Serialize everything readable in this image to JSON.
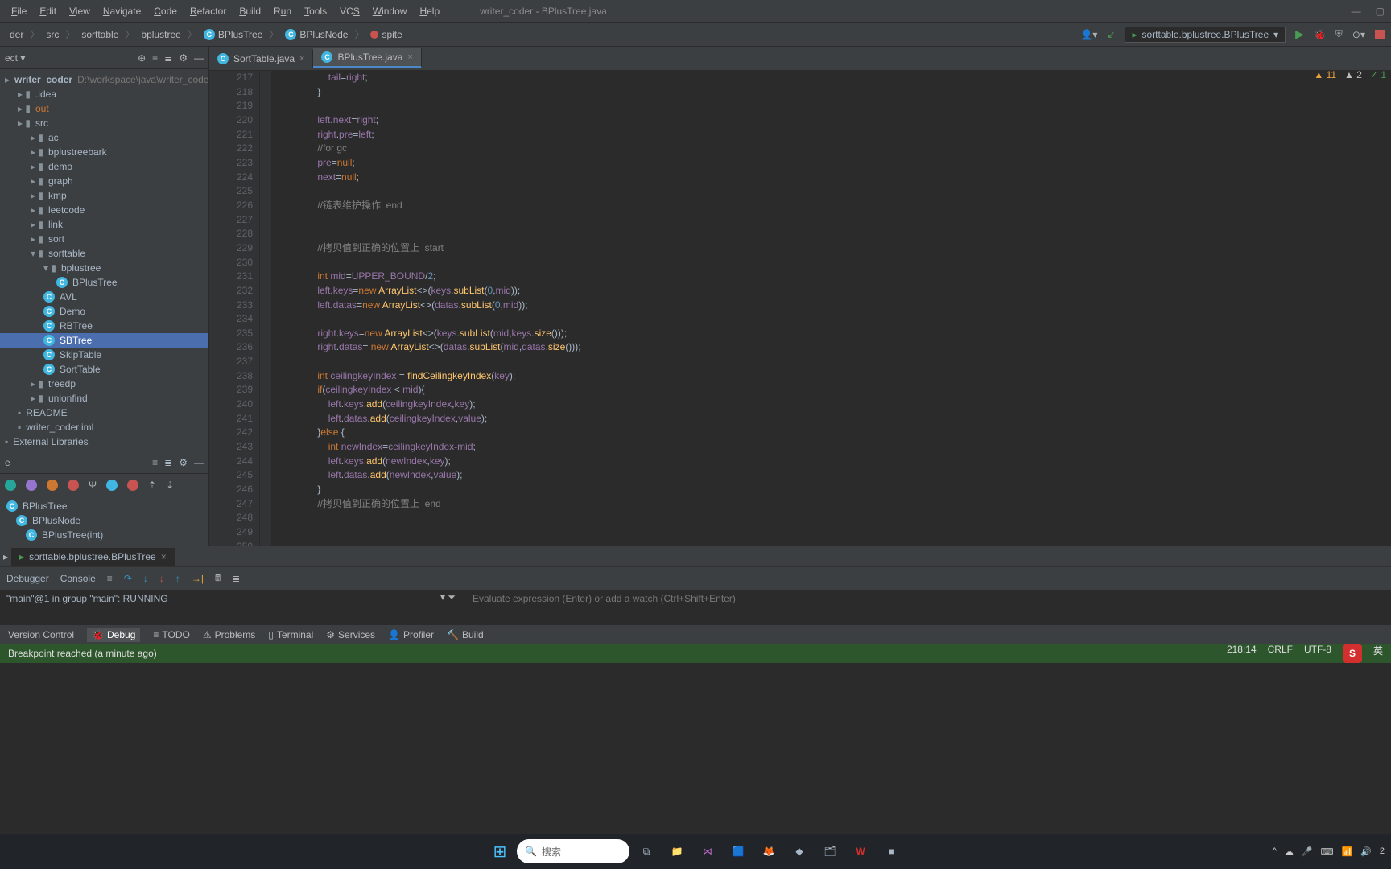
{
  "window_title": "writer_coder - BPlusTree.java",
  "menu": [
    "File",
    "Edit",
    "View",
    "Navigate",
    "Code",
    "Refactor",
    "Build",
    "Run",
    "Tools",
    "VCS",
    "Window",
    "Help"
  ],
  "breadcrumbs": [
    {
      "label": "writer_coder",
      "icon": "folder"
    },
    {
      "label": "src",
      "icon": null
    },
    {
      "label": "sorttable",
      "icon": null
    },
    {
      "label": "bplustree",
      "icon": null
    },
    {
      "label": "BPlusTree",
      "icon": "class"
    },
    {
      "label": "BPlusNode",
      "icon": "class"
    },
    {
      "label": "spite",
      "icon": "method"
    }
  ],
  "run_config": "sorttable.bplustree.BPlusTree",
  "project": {
    "root_label": "writer_coder",
    "root_path": "D:\\workspace\\java\\writer_code",
    "items": [
      {
        "label": ".idea",
        "type": "folder",
        "indent": 1
      },
      {
        "label": "out",
        "type": "folder-out",
        "indent": 1
      },
      {
        "label": "src",
        "type": "folder-src",
        "indent": 1
      },
      {
        "label": "ac",
        "type": "folder",
        "indent": 2
      },
      {
        "label": "bplustreebark",
        "type": "folder",
        "indent": 2
      },
      {
        "label": "demo",
        "type": "folder",
        "indent": 2
      },
      {
        "label": "graph",
        "type": "folder",
        "indent": 2
      },
      {
        "label": "kmp",
        "type": "folder",
        "indent": 2
      },
      {
        "label": "leetcode",
        "type": "folder",
        "indent": 2
      },
      {
        "label": "link",
        "type": "folder",
        "indent": 2
      },
      {
        "label": "sort",
        "type": "folder",
        "indent": 2
      },
      {
        "label": "sorttable",
        "type": "folder",
        "indent": 2,
        "expanded": true
      },
      {
        "label": "bplustree",
        "type": "folder",
        "indent": 3,
        "expanded": true
      },
      {
        "label": "BPlusTree",
        "type": "class",
        "indent": 4
      },
      {
        "label": "AVL",
        "type": "class",
        "indent": 3
      },
      {
        "label": "Demo",
        "type": "class",
        "indent": 3
      },
      {
        "label": "RBTree",
        "type": "class",
        "indent": 3
      },
      {
        "label": "SBTree",
        "type": "class",
        "indent": 3,
        "selected": true
      },
      {
        "label": "SkipTable",
        "type": "class",
        "indent": 3
      },
      {
        "label": "SortTable",
        "type": "class",
        "indent": 3
      },
      {
        "label": "treedp",
        "type": "folder",
        "indent": 2
      },
      {
        "label": "unionfind",
        "type": "folder",
        "indent": 2
      },
      {
        "label": "README",
        "type": "file",
        "indent": 1
      },
      {
        "label": "writer_coder.iml",
        "type": "file",
        "indent": 1
      },
      {
        "label": "External Libraries",
        "type": "lib",
        "indent": 0
      }
    ]
  },
  "structure_items": [
    {
      "label": "BPlusTree"
    },
    {
      "label": "BPlusNode"
    },
    {
      "label": "BPlusTree(int)"
    }
  ],
  "editor_tabs": [
    {
      "label": "SortTable.java",
      "icon": "class",
      "active": false
    },
    {
      "label": "BPlusTree.java",
      "icon": "class",
      "active": true
    }
  ],
  "inspections": {
    "warnings": 11,
    "weak": 2,
    "ok": "✓"
  },
  "code": {
    "first_line": 217,
    "lines": [
      "                    tail=right;",
      "                }",
      "",
      "                left.next=right;",
      "                right.pre=left;",
      "                //for gc",
      "                pre=null;",
      "                next=null;",
      "",
      "                //链表维护操作  end",
      "",
      "",
      "                //拷贝值到正确的位置上  start",
      "",
      "                int mid=UPPER_BOUND/2;",
      "                left.keys=new ArrayList<>(keys.subList(0,mid));",
      "                left.datas=new ArrayList<>(datas.subList(0,mid));",
      "",
      "                right.keys=new ArrayList<>(keys.subList(mid,keys.size()));",
      "                right.datas= new ArrayList<>(datas.subList(mid,datas.size()));",
      "",
      "                int ceilingkeyIndex = findCeilingkeyIndex(key);",
      "                if(ceilingkeyIndex < mid){",
      "                    left.keys.add(ceilingkeyIndex,key);",
      "                    left.datas.add(ceilingkeyIndex,value);",
      "                }else {",
      "                    int newIndex=ceilingkeyIndex-mid;",
      "                    left.keys.add(newIndex,key);",
      "                    left.datas.add(newIndex,value);",
      "                }",
      "                //拷贝值到正确的位置上  end",
      "",
      "",
      "",
      "",
      "            }"
    ]
  },
  "debug_tabs": [
    {
      "label": "sorttable.bplustree.BPlusTree",
      "active": true
    }
  ],
  "debugger_tabs": [
    "Debugger",
    "Console"
  ],
  "thread_text": "\"main\"@1 in group \"main\": RUNNING",
  "eval_placeholder": "Evaluate expression (Enter) or add a watch (Ctrl+Shift+Enter)",
  "bottom_tools": [
    {
      "label": "Version Control"
    },
    {
      "label": "Debug",
      "active": true,
      "icon": "bug"
    },
    {
      "label": "TODO",
      "icon": "list"
    },
    {
      "label": "Problems",
      "icon": "warn"
    },
    {
      "label": "Terminal",
      "icon": "term"
    },
    {
      "label": "Services",
      "icon": "gear"
    },
    {
      "label": "Profiler",
      "icon": "prof"
    },
    {
      "label": "Build",
      "icon": "hammer"
    }
  ],
  "status_text": "Breakpoint reached (a minute ago)",
  "status_right": {
    "pos": "218:14",
    "eol": "CRLF",
    "enc": "UTF-8"
  },
  "taskbar_search": "搜索",
  "ime_badge": "英",
  "taskbar_time": "2"
}
